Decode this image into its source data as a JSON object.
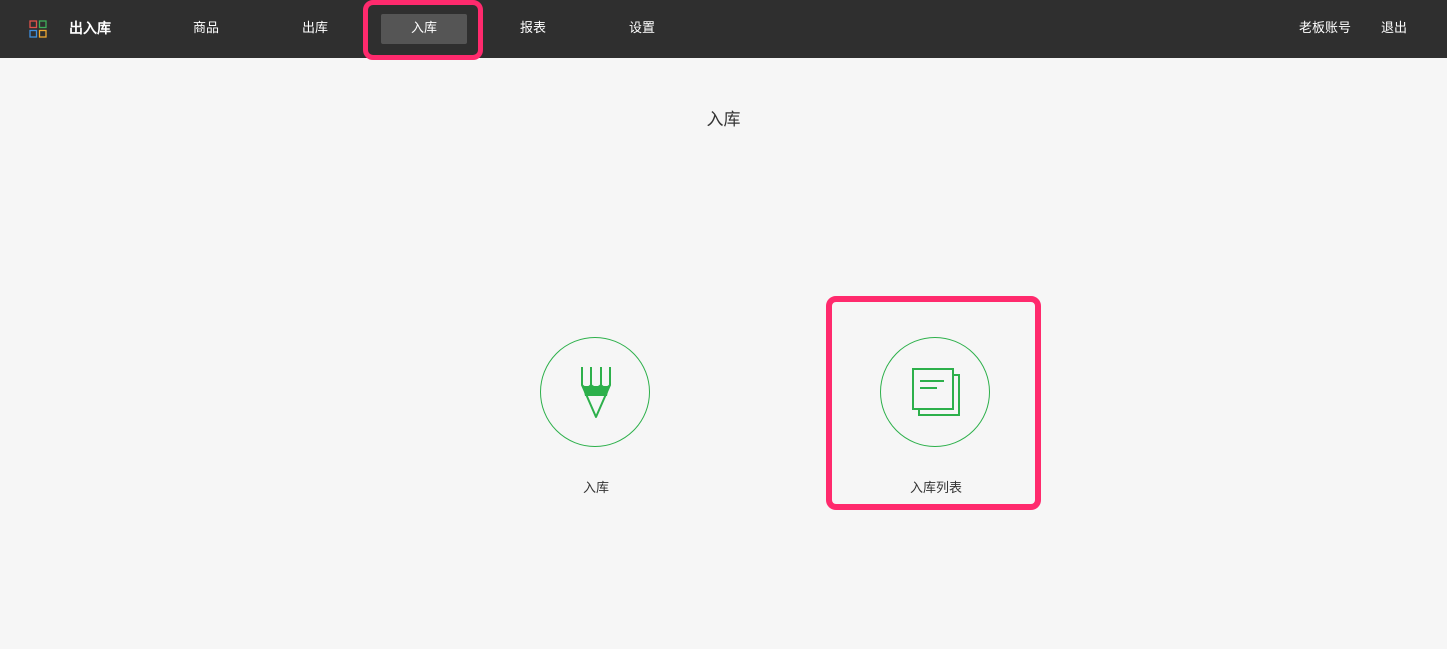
{
  "header": {
    "brand": "出入库",
    "nav": [
      {
        "label": "商品",
        "active": false
      },
      {
        "label": "出库",
        "active": false
      },
      {
        "label": "入库",
        "active": true
      },
      {
        "label": "报表",
        "active": false
      },
      {
        "label": "设置",
        "active": false
      }
    ],
    "account_label": "老板账号",
    "logout_label": "退出"
  },
  "main": {
    "title": "入库",
    "tiles": [
      {
        "label": "入库",
        "icon": "pen-icon"
      },
      {
        "label": "入库列表",
        "icon": "document-list-icon"
      }
    ]
  },
  "colors": {
    "topbar_bg": "#2f2f2f",
    "active_nav_bg": "#555555",
    "accent_green": "#2db04b",
    "highlight": "#ff2a6d",
    "page_bg": "#f6f6f6"
  }
}
